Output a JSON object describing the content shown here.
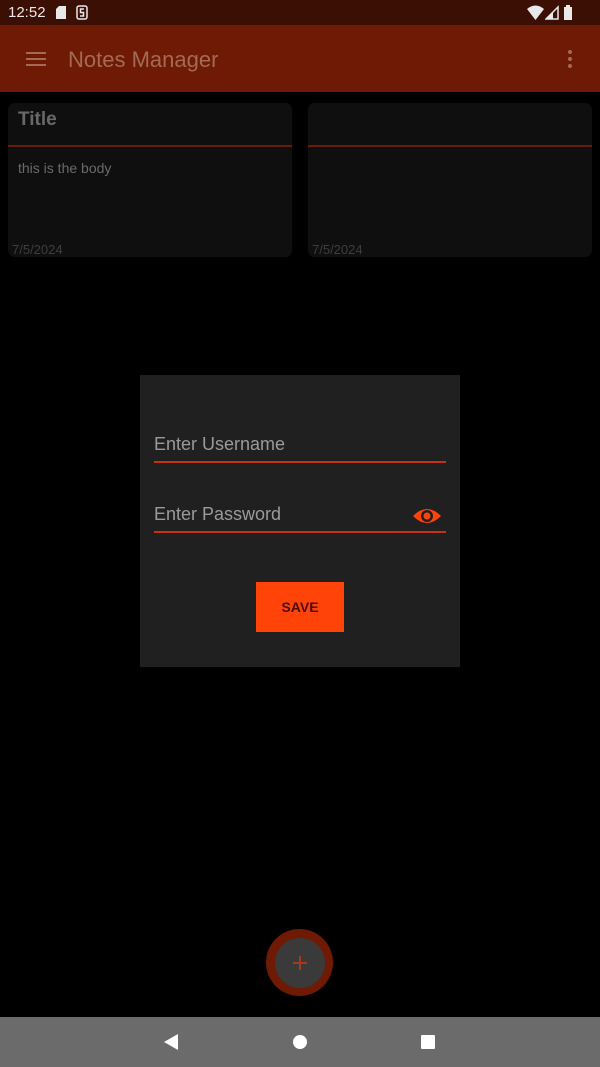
{
  "status_bar": {
    "time": "12:52",
    "icons": [
      "sd-card-icon",
      "s-notification-icon",
      "wifi-icon",
      "signal-icon",
      "battery-icon"
    ]
  },
  "app_bar": {
    "title": "Notes Manager",
    "icons": [
      "menu-icon",
      "overflow-menu-icon"
    ]
  },
  "notes": [
    {
      "title": "Title",
      "body": "this is the body",
      "date": "7/5/2024"
    },
    {
      "title": "",
      "body": "",
      "date": "7/5/2024"
    }
  ],
  "dialog": {
    "username_placeholder": "Enter Username",
    "password_placeholder": "Enter Password",
    "save_label": "SAVE"
  },
  "fab": {
    "icon": "plus-icon"
  },
  "nav_bar": {
    "icons": [
      "back-icon",
      "home-icon",
      "recents-icon"
    ]
  },
  "colors": {
    "app_bar": "#6e1a04",
    "status_bar": "#3b0f04",
    "accent": "#ff4309",
    "dialog_bg": "#202020",
    "card_bg": "#0f0f0f"
  }
}
